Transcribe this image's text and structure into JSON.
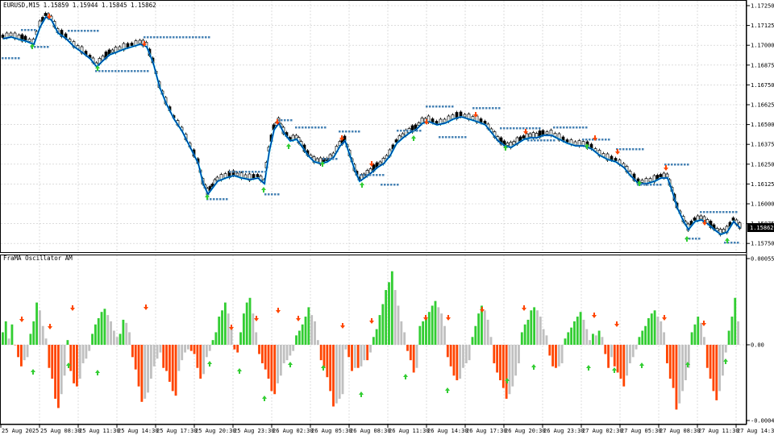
{
  "main_pane": {
    "title": "EURUSD,M15  1.15859 1.15944 1.15845 1.15862",
    "price_levels": [
      "1.17250",
      "1.17125",
      "1.17000",
      "1.16875",
      "1.16750",
      "1.16625",
      "1.16500",
      "1.16375",
      "1.16250",
      "1.16125",
      "1.16000",
      "1.15875",
      "1.15750"
    ],
    "current_price": "1.15862"
  },
  "oscillator_pane": {
    "title": "FraMA Oscillator AM",
    "levels": [
      "0.000551",
      "0.00",
      "-0.000491"
    ]
  },
  "time_labels": [
    "25 Aug 2025",
    "25 Aug 08:30",
    "25 Aug 11:30",
    "25 Aug 14:30",
    "25 Aug 17:30",
    "25 Aug 20:30",
    "25 Aug 23:30",
    "26 Aug 02:30",
    "26 Aug 05:30",
    "26 Aug 08:30",
    "26 Aug 11:30",
    "26 Aug 14:30",
    "26 Aug 17:30",
    "26 Aug 20:30",
    "26 Aug 23:30",
    "27 Aug 02:30",
    "27 Aug 05:30",
    "27 Aug 08:30",
    "27 Aug 11:30",
    "27 Aug 14:30"
  ],
  "colors": {
    "grid": "#c8c8c8",
    "candle": "#000000",
    "frama_line": "#00c8f0",
    "frama_dark": "#000080",
    "dots": "#4682b4",
    "bar_up": "#32cd32",
    "bar_down": "#ff4500",
    "bar_neutral": "#c0c0c0",
    "arrow_up": "#32cd32",
    "arrow_down": "#ff4500"
  },
  "chart_data": {
    "type": "bar",
    "title": "FraMA Oscillator AM",
    "ylim": [
      -0.000491,
      0.000551
    ],
    "values": [
      8e-05,
      0.00015,
      4e-05,
      0.00013,
      0,
      -8e-05,
      -0.00014,
      -0.0001,
      -8e-05,
      7e-05,
      0.00015,
      0.00027,
      0.00022,
      0.00012,
      4e-05,
      -0.00015,
      -0.00022,
      -0.00035,
      -0.00041,
      -0.00032,
      -0.0002,
      3e-05,
      -0.00017,
      -0.00025,
      -0.00027,
      -0.00022,
      -0.00012,
      -9e-05,
      -4e-05,
      7e-05,
      0.00013,
      0.00017,
      0.00021,
      0.00023,
      0.00019,
      0.00015,
      9e-05,
      5e-05,
      7e-05,
      0.00016,
      0.00014,
      8e-05,
      -8e-05,
      -0.00016,
      -0.00027,
      -0.00037,
      -0.00035,
      -0.00031,
      -0.00022,
      -0.00014,
      -9e-05,
      -5e-05,
      -0.00015,
      -0.00017,
      -0.00024,
      -0.0003,
      -0.00033,
      -0.00017,
      -0.0001,
      -5e-05,
      -3e-05,
      -4e-05,
      -6e-05,
      -0.00015,
      -0.00022,
      -0.00019,
      -8e-05,
      -4e-05,
      3e-05,
      8e-05,
      0.00018,
      0.00022,
      0.00027,
      0.0002,
      0.00011,
      -3e-05,
      -5e-05,
      8e-05,
      0.0002,
      0.00027,
      0.0003,
      0.0002,
      8e-05,
      -6e-05,
      -0.00012,
      -0.00016,
      -0.00022,
      -0.0003,
      -0.00032,
      -0.00025,
      -0.0002,
      -0.00012,
      -0.0001,
      -7e-05,
      -4e-05,
      6e-05,
      9e-05,
      0.00013,
      0.00018,
      0.00024,
      0.00019,
      0.00015,
      3e-05,
      -0.0001,
      -0.00015,
      -0.00021,
      -0.0003,
      -0.0004,
      -0.00038,
      -0.00035,
      -0.00032,
      -3e-05,
      -8e-05,
      -0.00017,
      -0.00015,
      -0.00015,
      -0.00014,
      -0.0001,
      -0.0001,
      -5e-05,
      5e-05,
      0.0001,
      0.00019,
      0.00026,
      0.00035,
      0.0004,
      0.00047,
      0.00035,
      0.00025,
      0.00015,
      8e-05,
      -4e-05,
      -0.0001,
      -0.00018,
      -0.00015,
      0.00012,
      0.00015,
      0.00017,
      0.00021,
      0.00025,
      0.00028,
      0.00024,
      0.0002,
      0.00012,
      -8e-05,
      -0.00014,
      -0.0002,
      -0.00023,
      -0.00022,
      -0.00015,
      -0.00012,
      -0.0001,
      5e-05,
      0.00012,
      0.0002,
      0.00025,
      0.00022,
      0.00016,
      5e-05,
      -0.00012,
      -0.00018,
      -0.00023,
      -0.00028,
      -0.00035,
      -0.00032,
      -0.00027,
      -0.0002,
      -0.00012,
      8e-05,
      0.00013,
      0.00016,
      0.00022,
      0.00024,
      0.00022,
      0.00018,
      0.0001,
      6e-05,
      -7e-05,
      -0.00014,
      -0.00015,
      -0.00014,
      -0.00012,
      4e-05,
      8e-05,
      0.00011,
      0.00015,
      0.00018,
      0.00021,
      0.00016,
      0.0001,
      3e-05,
      7e-05,
      6e-05,
      9e-05,
      5e-05,
      -6e-05,
      -0.00015,
      -8e-05,
      -0.00014,
      -0.00018,
      -0.00022,
      -0.00027,
      -0.0002,
      -0.00012,
      -8e-05,
      -3e-05,
      5e-05,
      9e-05,
      0.00012,
      0.00017,
      0.0002,
      0.00022,
      0.00018,
      0.00015,
      8e-05,
      -0.00012,
      -0.00022,
      -0.00028,
      -0.00042,
      -0.00038,
      -0.0003,
      -0.00023,
      -0.00015,
      8e-05,
      0.00013,
      0.00018,
      0.00014,
      5e-05,
      -0.00015,
      -0.00022,
      -0.0003,
      -0.00036,
      -0.0003,
      -0.0002,
      -5e-05,
      9e-05,
      0.00018,
      0.0003,
      0.00015
    ]
  }
}
